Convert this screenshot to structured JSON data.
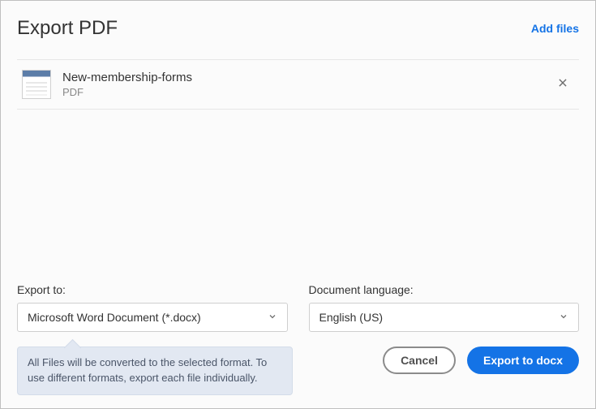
{
  "header": {
    "title": "Export PDF",
    "add_files": "Add files"
  },
  "file": {
    "name": "New-membership-forms",
    "type": "PDF"
  },
  "form": {
    "export_label": "Export to:",
    "export_value": "Microsoft Word Document (*.docx)",
    "lang_label": "Document language:",
    "lang_value": "English (US)"
  },
  "tooltip": "All Files will be converted to the selected format. To use different formats, export each file individually.",
  "buttons": {
    "cancel": "Cancel",
    "export": "Export to docx"
  }
}
